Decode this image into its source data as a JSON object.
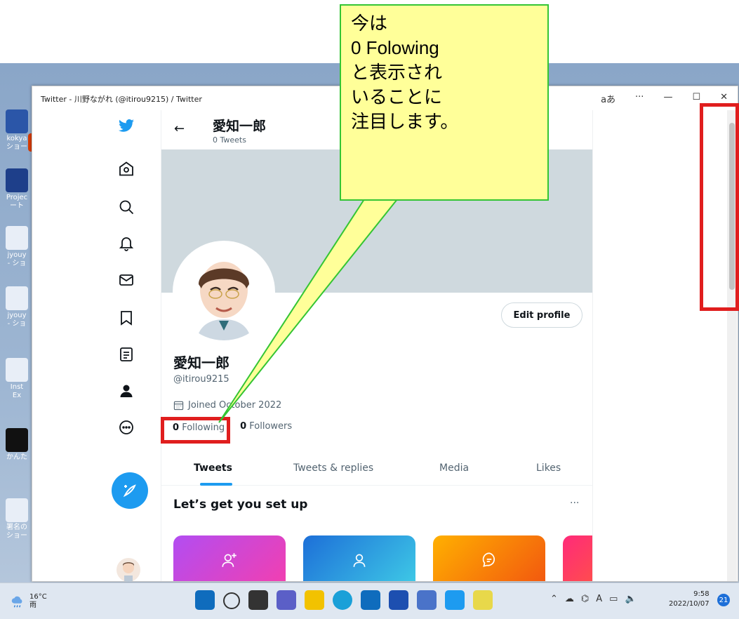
{
  "window": {
    "title": "Twitter - 川野ながれ (@itirou9215) / Twitter",
    "controls": {
      "lang": "aあ",
      "more": "···",
      "minimize": "—",
      "maximize": "☐",
      "close": "✕"
    }
  },
  "header": {
    "back": "←",
    "name": "愛知一郎",
    "tweet_count": "0 Tweets"
  },
  "profile": {
    "name": "愛知一郎",
    "handle": "@itirou9215",
    "joined": "Joined October 2022",
    "following_count": "0",
    "following_label": "Following",
    "followers_count": "0",
    "followers_label": "Followers",
    "edit_button": "Edit profile"
  },
  "tabs": [
    {
      "label": "Tweets",
      "active": true
    },
    {
      "label": "Tweets & replies",
      "active": false
    },
    {
      "label": "Media",
      "active": false
    },
    {
      "label": "Likes",
      "active": false
    }
  ],
  "setup": {
    "title": "Let’s get you set up",
    "more": "···"
  },
  "callout": {
    "text": "今は\n0 Folowing\nと表示され\nいることに\n注目します。"
  },
  "taskbar": {
    "temp": "16°C",
    "weather": "雨",
    "time": "9:58",
    "date": "2022/10/07",
    "notifications": "21",
    "ime": "A"
  },
  "desktop_labels": [
    "kokya\nショー",
    "Projec\nート",
    "jyouy\n- ショ",
    "jyouy\n- ショ",
    "Inst\nEx",
    "かんた",
    "署名の\nショー"
  ],
  "colors": {
    "twitter_blue": "#1d9bf0",
    "callout_fill": "#ffff99",
    "callout_border": "#34c534",
    "highlight_red": "#e01e1e"
  }
}
